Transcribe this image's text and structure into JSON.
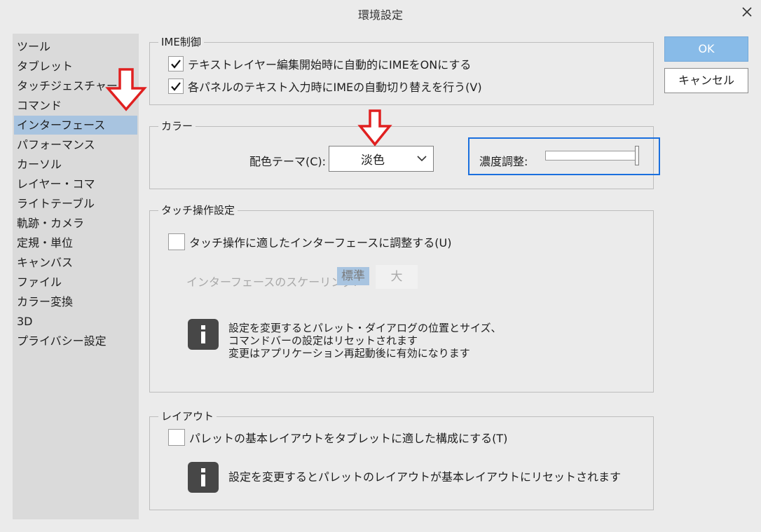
{
  "window": {
    "title": "環境設定"
  },
  "sidebar": {
    "items": [
      {
        "label": "ツール"
      },
      {
        "label": "タブレット"
      },
      {
        "label": "タッチジェスチャー"
      },
      {
        "label": "コマンド"
      },
      {
        "label": "インターフェース",
        "selected": true
      },
      {
        "label": "パフォーマンス"
      },
      {
        "label": "カーソル"
      },
      {
        "label": "レイヤー・コマ"
      },
      {
        "label": "ライトテーブル"
      },
      {
        "label": "軌跡・カメラ"
      },
      {
        "label": "定規・単位"
      },
      {
        "label": "キャンバス"
      },
      {
        "label": "ファイル"
      },
      {
        "label": "カラー変換"
      },
      {
        "label": "3D"
      },
      {
        "label": "プライバシー設定"
      }
    ]
  },
  "ime": {
    "title": "IME制御",
    "options": [
      {
        "label": "テキストレイヤー編集開始時に自動的にIMEをONにする",
        "checked": true
      },
      {
        "label": "各パネルのテキスト入力時にIMEの自動切り替えを行う(V)",
        "checked": true
      }
    ]
  },
  "color": {
    "title": "カラー",
    "theme_label": "配色テーマ(C):",
    "theme_value": "淡色",
    "density_label": "濃度調整:",
    "density_level": 1.0
  },
  "touch": {
    "title": "タッチ操作設定",
    "option_label": "タッチ操作に適したインターフェースに調整する(U)",
    "option_checked": false,
    "scaling_label": "インターフェースのスケーリング:",
    "scaling_options": [
      "標準",
      "大"
    ],
    "scaling_selected": "標準",
    "info_lines": [
      "設定を変更するとパレット・ダイアログの位置とサイズ、",
      "コマンドバーの設定はリセットされます",
      "変更はアプリケーション再起動後に有効になります"
    ]
  },
  "layout": {
    "title": "レイアウト",
    "option_label": "パレットの基本レイアウトをタブレットに適した構成にする(T)",
    "option_checked": false,
    "info_text": "設定を変更するとパレットのレイアウトが基本レイアウトにリセットされます"
  },
  "buttons": {
    "ok": "OK",
    "cancel": "キャンセル"
  },
  "colors": {
    "selection": "#a8c4e0",
    "ok_button": "#88bbe8",
    "highlight_box": "#1a6fde",
    "annotation_arrow": "#e02020"
  }
}
